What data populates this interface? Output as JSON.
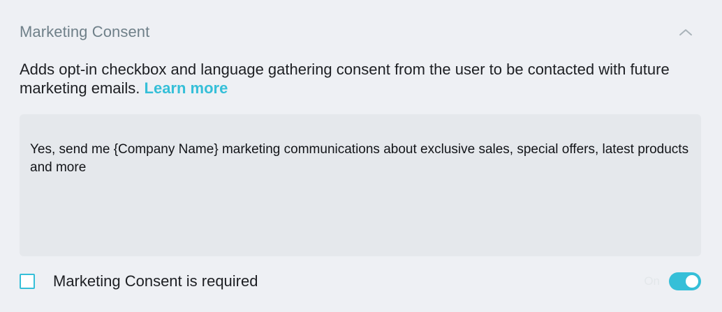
{
  "section": {
    "title": "Marketing Consent",
    "description": "Adds opt-in checkbox and language gathering consent from the user to be contacted with future marketing emails. ",
    "learn_more_label": "Learn more"
  },
  "consent_text": "Yes, send me {Company Name} marketing communications about exclusive sales, special offers, latest products and more",
  "required_option": {
    "label": "Marketing Consent is required",
    "checked": false,
    "toggle_status": "On",
    "toggle_on": true
  },
  "icons": {
    "collapse": "chevron-up-icon"
  },
  "colors": {
    "accent": "#35bfd8",
    "title": "#6f8089",
    "background": "#eef0f4",
    "text_area": "#e5e8ec"
  }
}
